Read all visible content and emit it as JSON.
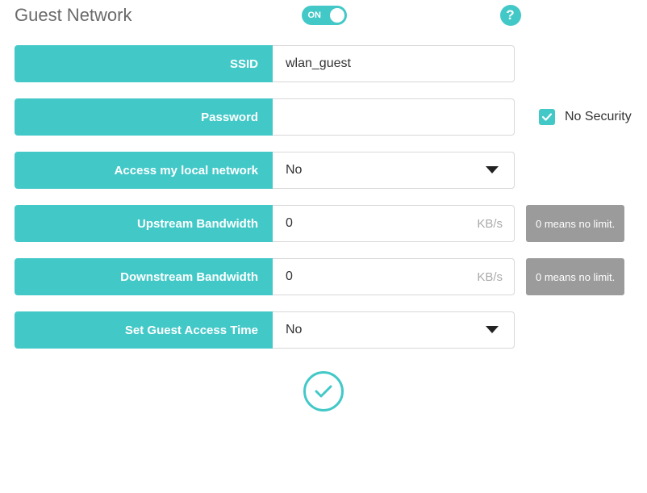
{
  "header": {
    "title": "Guest Network",
    "toggle_state": "ON"
  },
  "fields": {
    "ssid": {
      "label": "SSID",
      "value": "wlan_guest"
    },
    "password": {
      "label": "Password",
      "value": "",
      "no_security_label": "No Security",
      "no_security_checked": true
    },
    "access_local": {
      "label": "Access my local network",
      "value": "No"
    },
    "upstream": {
      "label": "Upstream Bandwidth",
      "value": "0",
      "unit": "KB/s",
      "note": "0 means no limit."
    },
    "downstream": {
      "label": "Downstream Bandwidth",
      "value": "0",
      "unit": "KB/s",
      "note": "0 means no limit."
    },
    "access_time": {
      "label": "Set Guest Access Time",
      "value": "No"
    }
  }
}
